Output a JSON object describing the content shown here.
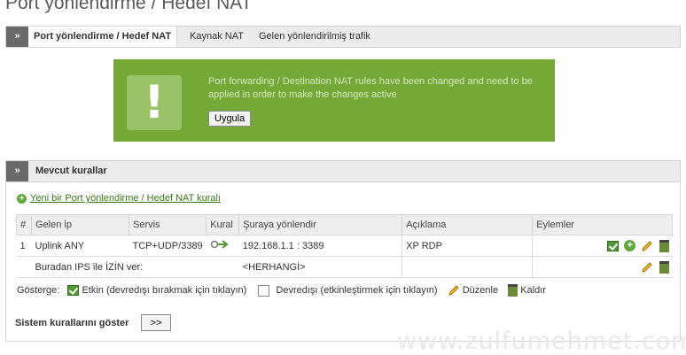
{
  "page_title": "Port yönlendirme / Hedef NAT",
  "tabs": {
    "arrow": "»",
    "items": [
      {
        "label": "Port yönlendirme / Hedef NAT"
      },
      {
        "label": "Kaynak NAT"
      },
      {
        "label": "Gelen yönlendirilmiş trafik"
      }
    ]
  },
  "notice": {
    "icon": "!",
    "message": "Port forwarding / Destination NAT rules have been changed and need to be applied in order to make the changes active",
    "apply_label": "Uygula"
  },
  "panel": {
    "arrow": "»",
    "title": "Mevcut kurallar",
    "add_link": "Yeni bir Port yönlendirme / Hedef NAT kuralı",
    "columns": [
      "#",
      "Gelen ip",
      "Servis",
      "Kural",
      "Şuraya yönlendir",
      "Açıklama",
      "Eylemler"
    ],
    "rows": [
      {
        "num": "1",
        "gelen_ip": "Uplink ANY",
        "servis": "TCP+UDP/3389",
        "yonlendir": "192.168.1.1 : 3389",
        "aciklama": "XP RDP"
      },
      {
        "num": "",
        "gelen_ip": "Buradan IPS ile İZİN ver:",
        "servis": "",
        "yonlendir": "<HERHANGİ>",
        "aciklama": ""
      }
    ],
    "legend": {
      "label": "Gösterge:",
      "enabled": "Etkin (devredışı bırakmak için tıklayın)",
      "disabled": "Devredışı (etkinleştirmek için tıklayın)",
      "edit": "Düzenle",
      "remove": "Kaldır"
    },
    "system_rules_label": "Sistem kurallarını göster",
    "system_rules_button": ">>"
  },
  "watermark": "www.zulfumehmet.com",
  "colors": {
    "notice_bg": "#76a838",
    "link_green": "#3a7a1a",
    "red_text": "#a81e1e"
  }
}
